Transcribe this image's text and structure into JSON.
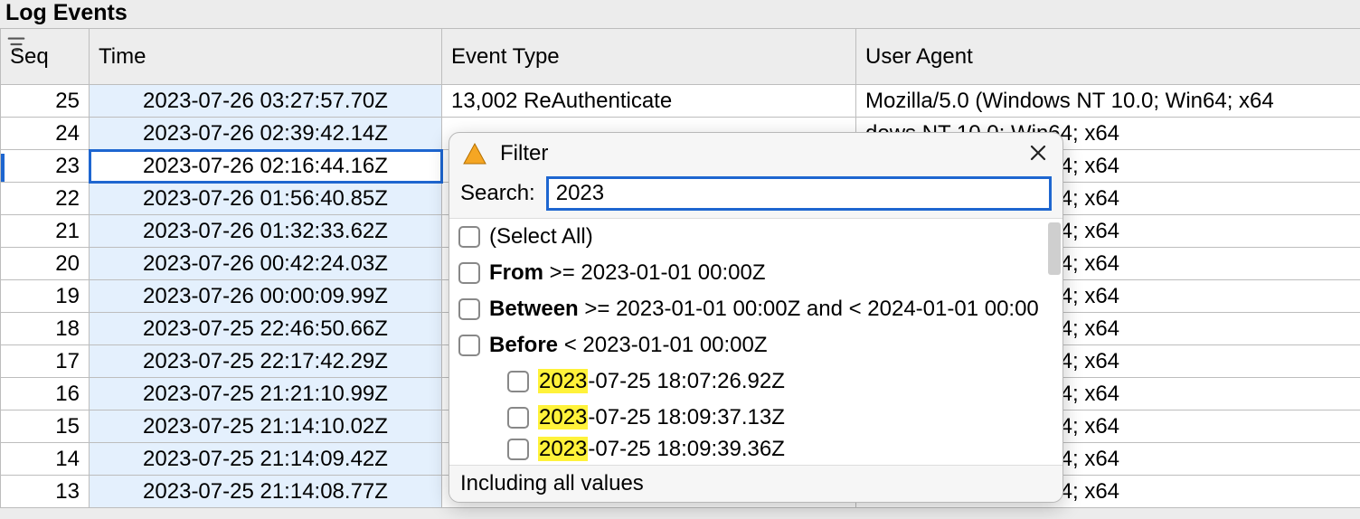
{
  "panel": {
    "title": "Log Events"
  },
  "columns": {
    "seq": "Seq",
    "time": "Time",
    "event": "Event Type",
    "ua": "User Agent"
  },
  "rows": [
    {
      "seq": "25",
      "time": "2023-07-26 03:27:57.70Z",
      "event": "13,002 ReAuthenticate",
      "ua": "Mozilla/5.0 (Windows NT 10.0; Win64; x64"
    },
    {
      "seq": "24",
      "time": "2023-07-26 02:39:42.14Z",
      "event": "",
      "ua": "dows NT 10.0; Win64; x64"
    },
    {
      "seq": "23",
      "time": "2023-07-26 02:16:44.16Z",
      "event": "",
      "ua": "dows NT 10.0; Win64; x64",
      "selected": true
    },
    {
      "seq": "22",
      "time": "2023-07-26 01:56:40.85Z",
      "event": "",
      "ua": "dows NT 10.0; Win64; x64"
    },
    {
      "seq": "21",
      "time": "2023-07-26 01:32:33.62Z",
      "event": "",
      "ua": "dows NT 10.0; Win64; x64"
    },
    {
      "seq": "20",
      "time": "2023-07-26 00:42:24.03Z",
      "event": "",
      "ua": "dows NT 10.0; Win64; x64"
    },
    {
      "seq": "19",
      "time": "2023-07-26 00:00:09.99Z",
      "event": "",
      "ua": "dows NT 10.0; Win64; x64"
    },
    {
      "seq": "18",
      "time": "2023-07-25 22:46:50.66Z",
      "event": "",
      "ua": "dows NT 10.0; Win64; x64"
    },
    {
      "seq": "17",
      "time": "2023-07-25 22:17:42.29Z",
      "event": "",
      "ua": "dows NT 10.0; Win64; x64"
    },
    {
      "seq": "16",
      "time": "2023-07-25 21:21:10.99Z",
      "event": "",
      "ua": "dows NT 10.0; Win64; x64"
    },
    {
      "seq": "15",
      "time": "2023-07-25 21:14:10.02Z",
      "event": "",
      "ua": "dows NT 10.0; Win64; x64"
    },
    {
      "seq": "14",
      "time": "2023-07-25 21:14:09.42Z",
      "event": "",
      "ua": "dows NT 10.0; Win64; x64"
    },
    {
      "seq": "13",
      "time": "2023-07-25 21:14:08.77Z",
      "event": "",
      "ua": "dows NT 10.0; Win64; x64"
    }
  ],
  "filter": {
    "title": "Filter",
    "search_label": "Search:",
    "search_value": "2023",
    "select_all": "(Select All)",
    "from_label": "From",
    "from_expr": ">= 2023-01-01 00:00Z",
    "between_label": "Between",
    "between_expr": ">= 2023-01-01 00:00Z and < 2024-01-01 00:00",
    "before_label": "Before",
    "before_expr": "< 2023-01-01 00:00Z",
    "values": [
      {
        "hl": "2023",
        "rest": "-07-25 18:07:26.92Z"
      },
      {
        "hl": "2023",
        "rest": "-07-25 18:09:37.13Z"
      },
      {
        "hl": "2023",
        "rest": "-07-25 18:09:39.36Z"
      }
    ],
    "footer": "Including all values"
  }
}
